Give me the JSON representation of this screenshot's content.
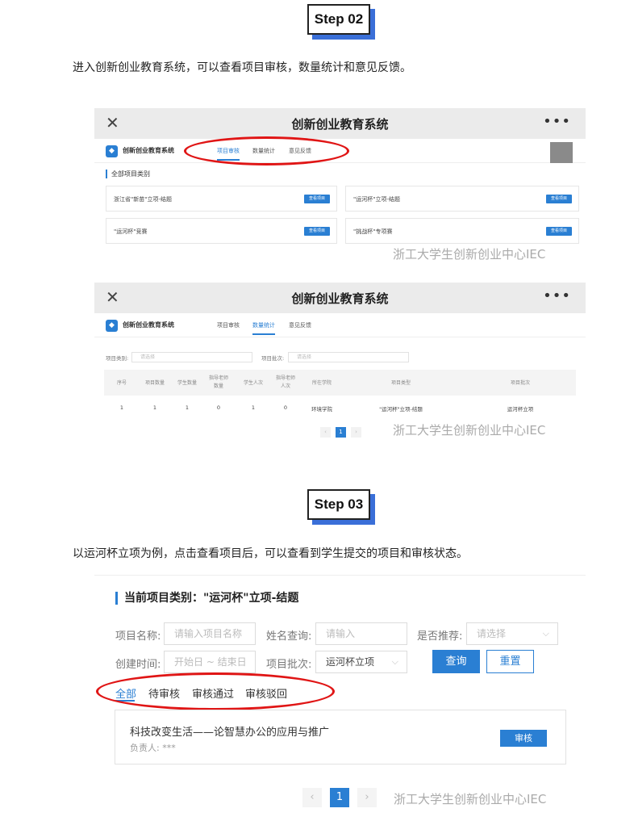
{
  "step2": {
    "label": "Step 02",
    "text": "进入创新创业教育系统，可以查看项目审核，数量统计和意见反馈。"
  },
  "shot1": {
    "title": "创新创业教育系统",
    "close": "✕",
    "more": "•••",
    "app_name": "创新创业教育系统",
    "tabs": [
      "项目审核",
      "数量统计",
      "意见反馈"
    ],
    "section": "全部项目类别",
    "cards": [
      {
        "name": "浙江省\"新苗\"立项-结题",
        "btn": "查看项目"
      },
      {
        "name": "\"运河杯\"立项-结题",
        "btn": "查看项目"
      },
      {
        "name": "\"运河杯\"竞赛",
        "btn": "查看项目"
      },
      {
        "name": "\"挑战杯\"专项赛",
        "btn": "查看项目"
      }
    ],
    "watermark": "浙工大学生创新创业中心IEC"
  },
  "shot2": {
    "title": "创新创业教育系统",
    "close": "✕",
    "more": "•••",
    "app_name": "创新创业教育系统",
    "tabs": [
      "项目审核",
      "数量统计",
      "意见反馈"
    ],
    "filter1_label": "项目类别:",
    "filter1_placeholder": "请选择",
    "filter2_label": "项目批次:",
    "filter2_placeholder": "请选择",
    "columns": [
      "序号",
      "项目数量",
      "学生数量",
      "指导老师数量",
      "学生人次",
      "指导老师人次",
      "所在学院",
      "项目类型",
      "项目批次"
    ],
    "row": [
      "1",
      "1",
      "1",
      "0",
      "1",
      "0",
      "环境学院",
      "\"运河杯\"立项-结题",
      "运河杯立项"
    ],
    "page_prev": "‹",
    "page_current": "1",
    "page_next": "›",
    "watermark": "浙工大学生创新创业中心IEC"
  },
  "step3": {
    "label": "Step 03",
    "text": "以运河杯立项为例，点击查看项目后，可以查看到学生提交的项目和审核状态。"
  },
  "shot3": {
    "title": "当前项目类别：\"运河杯\"立项-结题",
    "name_label": "项目名称:",
    "name_placeholder": "请输入项目名称",
    "person_label": "姓名查询:",
    "person_placeholder": "请输入",
    "recommend_label": "是否推荐:",
    "recommend_placeholder": "请选择",
    "date_label": "创建时间:",
    "date_placeholder": "开始日 ~ 结束日",
    "batch_label": "项目批次:",
    "batch_value": "运河杯立项",
    "query_btn": "查询",
    "reset_btn": "重置",
    "tabs": [
      "全部",
      "待审核",
      "审核通过",
      "审核驳回"
    ],
    "project_title": "科技改变生活——论智慧办公的应用与推广",
    "project_owner": "负责人: ***",
    "review_btn": "审核",
    "page_prev": "‹",
    "page_current": "1",
    "page_next": "›",
    "watermark": "浙工大学生创新创业中心IEC"
  },
  "colors": {
    "accent": "#2a7fd3",
    "highlight_oval": "#e01515",
    "step_shadow": "#3a6fd8"
  }
}
